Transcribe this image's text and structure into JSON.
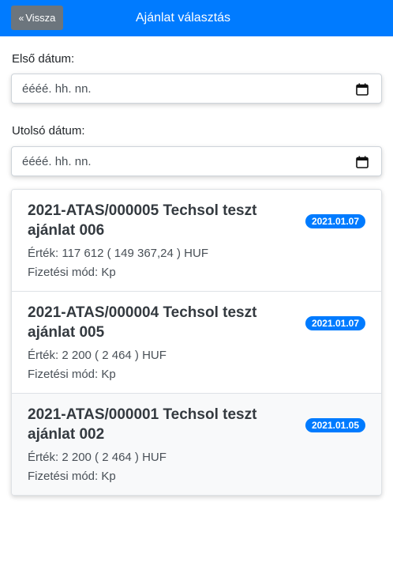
{
  "header": {
    "back_label": "Vissza",
    "back_icon": "chevron-double-left-icon",
    "title": "Ajánlat választás",
    "bg_color": "#007bff"
  },
  "filters": {
    "first_date_label": "Első dátum:",
    "first_date_placeholder": "éééé. hh. nn.",
    "last_date_label": "Utolsó dátum:",
    "last_date_placeholder": "éééé. hh. nn.",
    "calendar_icon": "calendar-icon"
  },
  "offers": [
    {
      "title": "2021-ATAS/000005 Techsol teszt ajánlat 006",
      "date": "2021.01.07",
      "value": "Érték: 117 612 ( 149 367,24 ) HUF",
      "payment": "Fizetési mód: Kp"
    },
    {
      "title": "2021-ATAS/000004 Techsol teszt ajánlat 005",
      "date": "2021.01.07",
      "value": "Érték: 2 200 ( 2 464 ) HUF",
      "payment": "Fizetési mód: Kp"
    },
    {
      "title": "2021-ATAS/000001 Techsol teszt ajánlat 002",
      "date": "2021.01.05",
      "value": "Érték: 2 200 ( 2 464 ) HUF",
      "payment": "Fizetési mód: Kp"
    }
  ]
}
